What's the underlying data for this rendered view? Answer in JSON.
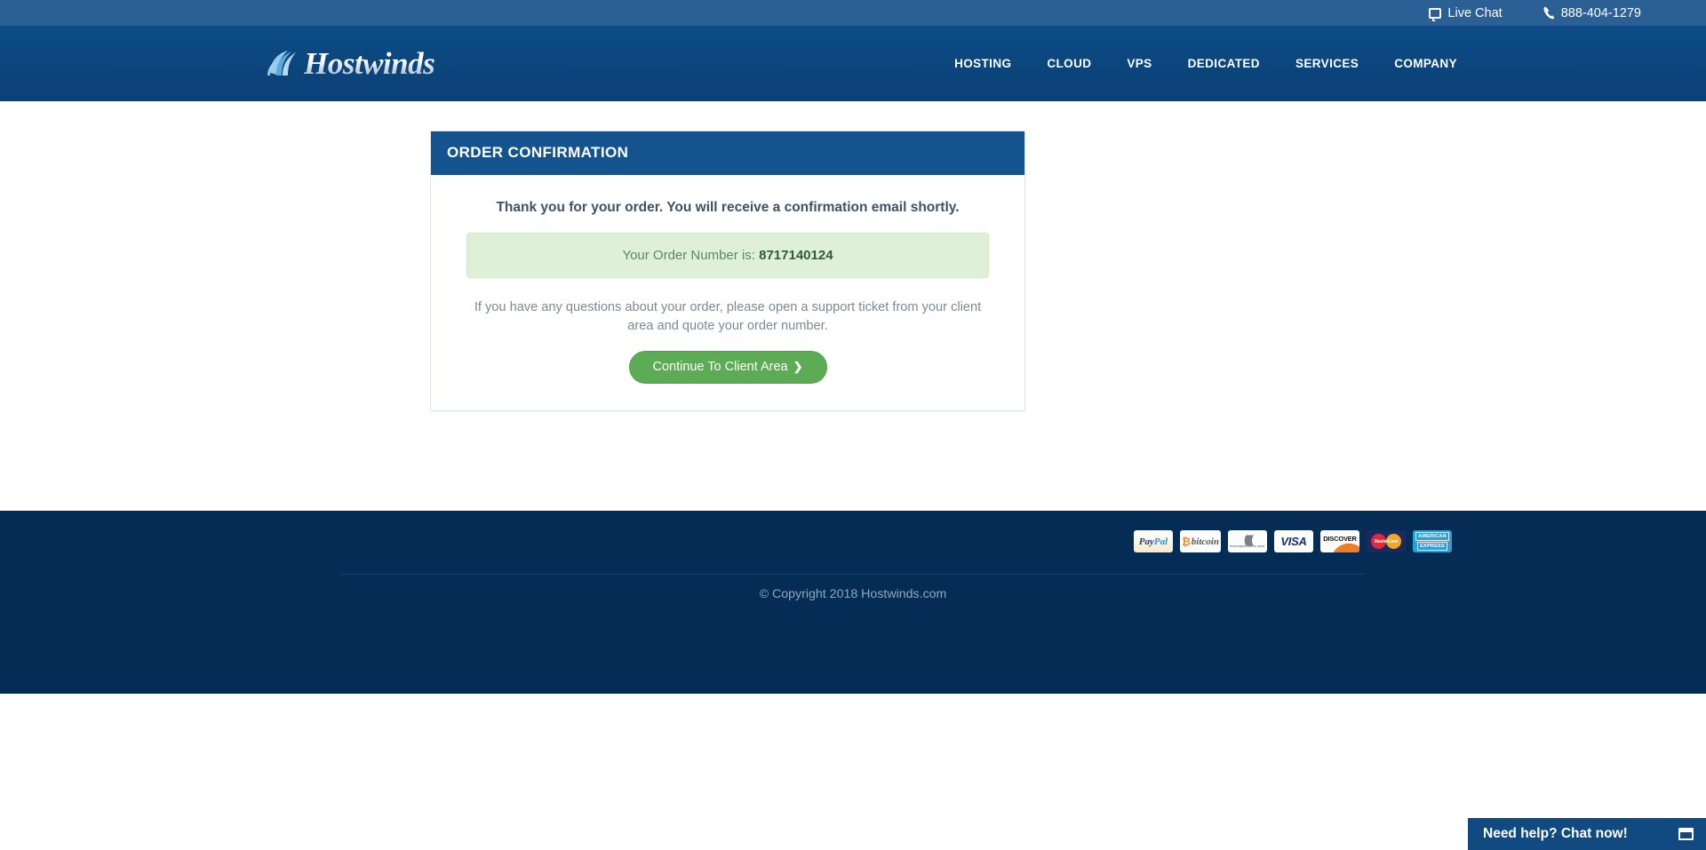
{
  "topbar": {
    "live_chat_label": "Live Chat",
    "phone_label": "888-404-1279",
    "chat_icon": "chat-bubble-icon",
    "phone_icon": "phone-icon",
    "background_color": "#2a6094"
  },
  "header": {
    "logo_text": "Hostwinds",
    "logo_mark_icon": "wave-swoosh-icon",
    "background_color": "#0b457c",
    "nav": [
      {
        "label": "HOSTING"
      },
      {
        "label": "CLOUD"
      },
      {
        "label": "VPS"
      },
      {
        "label": "DEDICATED"
      },
      {
        "label": "SERVICES"
      },
      {
        "label": "COMPANY"
      }
    ]
  },
  "panel": {
    "heading": "ORDER CONFIRMATION",
    "heading_background": "#14538d",
    "lead": "Thank you for your order. You will receive a confirmation email shortly.",
    "order_number_prefix": "Your Order Number is:",
    "order_number": "8717140124",
    "alert_background": "#dff0d8",
    "alert_text_color": "#5a8a5f",
    "note": "If you have any questions about your order, please open a support ticket from your client area and quote your order number.",
    "continue_button_label": "Continue To Client Area",
    "continue_button_chevron": "❯",
    "continue_button_color": "#5cab55"
  },
  "footer": {
    "background_color": "#042c54",
    "copyright": "© Copyright 2018 Hostwinds.com",
    "payment_methods": [
      {
        "name": "paypal",
        "text_1": "Pay",
        "text_2": "Pal"
      },
      {
        "name": "bitcoin",
        "symbol": "₿",
        "text": "bitcoin"
      },
      {
        "name": "moneybookers",
        "arcs": "((((((",
        "text": "moneybookers.com"
      },
      {
        "name": "visa",
        "text": "VISA"
      },
      {
        "name": "discover",
        "text": "DISCOVER"
      },
      {
        "name": "mastercard",
        "text": "MasterCard"
      },
      {
        "name": "american-express",
        "line_1": "AMERICAN",
        "line_2": "EXPRESS"
      }
    ]
  },
  "chat_widget": {
    "label": "Need help? Chat now!",
    "icon": "window-icon",
    "background_color": "#104a80"
  }
}
